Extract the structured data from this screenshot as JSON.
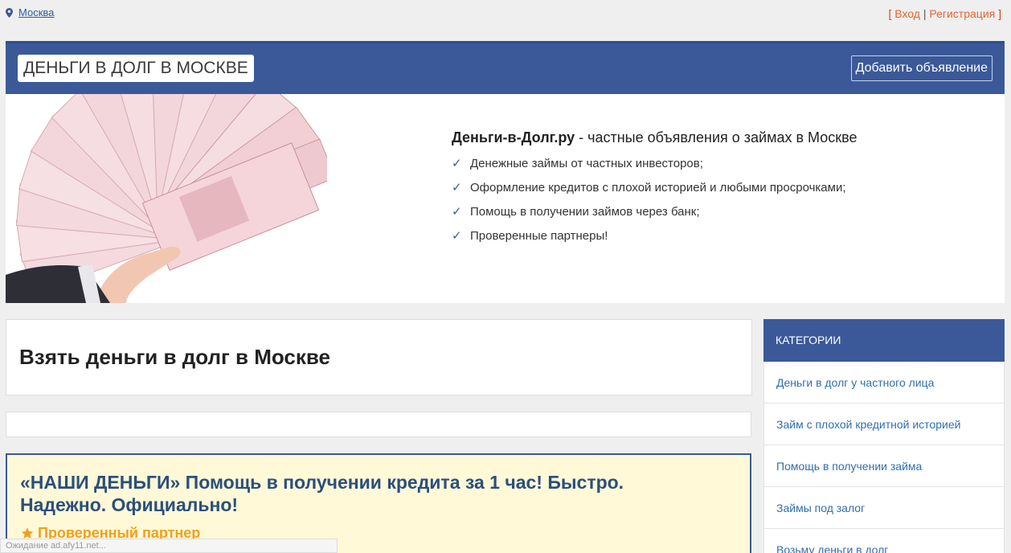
{
  "topbar": {
    "city": "Москва",
    "bracket_open": "[",
    "login": "Вход",
    "separator": "|",
    "register": "Регистрация",
    "bracket_close": "]"
  },
  "header": {
    "site_title": "ДЕНЬГИ В ДОЛГ В МОСКВЕ",
    "add_button": "Добавить объявление"
  },
  "hero": {
    "brand": "Деньги-в-Долг.ру",
    "dash": " - ",
    "tagline": "частные объявления о займах в Москве",
    "features": [
      "Денежные займы от частных инвесторов;",
      "Оформление кредитов с плохой историей и любыми просрочками;",
      "Помощь в получении займов через банк;",
      "Проверенные партнеры!"
    ],
    "check_glyph": "✓"
  },
  "main": {
    "page_title": "Взять деньги в долг в Москве",
    "ad": {
      "title": "«НАШИ ДЕНЬГИ» Помощь в получении кредита за 1 час! Быстро. Надежно. Официально!",
      "partner": "Проверенный партнер"
    }
  },
  "sidebar": {
    "heading": "КАТЕГОРИИ",
    "items": [
      "Деньги в долг у частного лица",
      "Займ с плохой кредитной историей",
      "Помощь в получении займа",
      "Займы под залог",
      "Возьму деньги в долг"
    ]
  },
  "status_bar": "Ожидание ad.afy11.net...",
  "colors": {
    "header_blue": "#3b5998",
    "link_orange": "#e8632b",
    "partner_orange": "#f2a01c",
    "ad_bg": "#fff9d7"
  },
  "icons": [
    "map-pin-icon",
    "check-icon",
    "star-icon"
  ]
}
